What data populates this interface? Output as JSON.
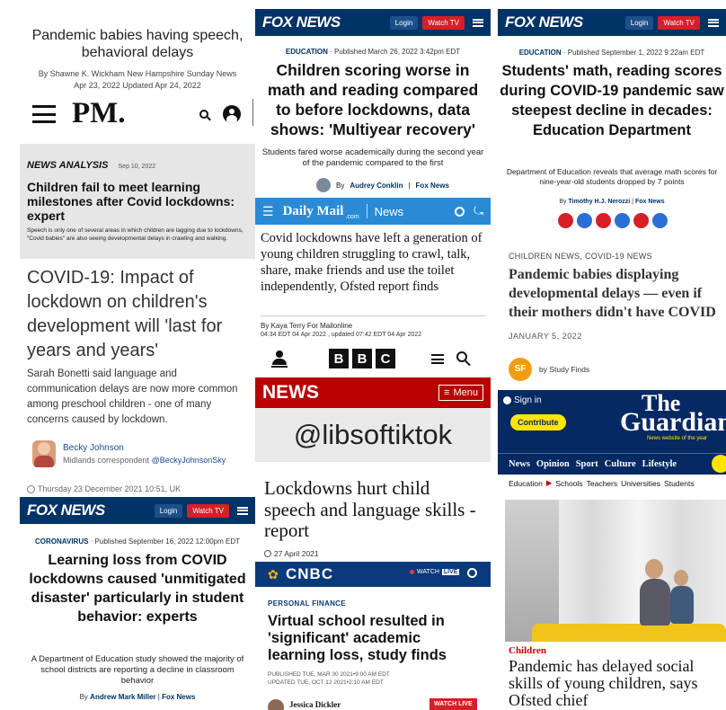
{
  "p1": {
    "title": "Pandemic babies having speech, behavioral delays",
    "byline": "By Shawne K. Wickham New Hampshire Sunday News",
    "dateline": "Apr 23, 2022 Updated Apr 24, 2022",
    "logo": "PM."
  },
  "p2": {
    "label": "NEWS ANALYSIS",
    "date": "Sep 10, 2022",
    "headline": "Children fail to meet learning milestones after Covid lockdowns: expert",
    "summary": "Speech is only one of several areas in which children are lagging due to lockdowns, \"Covid babies\" are also seeing developmental delays in crawling and walking."
  },
  "p3": {
    "headline": "COVID-19: Impact of lockdown on children's development will 'last for years and years'",
    "summary": "Sarah Bonetti said language and communication delays are now more common among preschool children - one of many concerns caused by lockdown.",
    "author": "Becky Johnson",
    "role": "Midlands correspondent",
    "handle": "@BeckyJohnsonSky",
    "timestamp": "Thursday 23 December 2021 10:51, UK"
  },
  "fox": {
    "logo": "FOX NEWS",
    "login": "Login",
    "watch": "Watch TV"
  },
  "p4": {
    "section": "CORONAVIRUS",
    "published": "Published September 16, 2022 12:00pm EDT",
    "headline": "Learning loss from COVID lockdowns caused 'unmitigated disaster' particularly in student behavior: experts",
    "summary": "A Department of Education study showed the majority of school districts are reporting a decline in classroom behavior",
    "byline_prefix": "By",
    "author": "Andrew Mark Miller",
    "outlet": "Fox News"
  },
  "p5": {
    "section": "EDUCATION",
    "published": "Published March 26, 2022 3:42pm EDT",
    "headline": "Children scoring worse in math and reading compared to before lockdowns, data shows: 'Multiyear recovery'",
    "summary": "Students fared worse academically during the second year of the pandemic compared to the first",
    "byline_prefix": "By",
    "author": "Audrey Conklin",
    "outlet": "Fox News"
  },
  "p6": {
    "brand": "Daily Mail",
    "brand_sub": ".com",
    "section": "News",
    "headline": "Covid lockdowns have left a generation of young children struggling to crawl, talk, share, make friends and use the toilet independently, Ofsted report finds",
    "byline": "By Kaya Terry For Mailonline",
    "timestamp": "04:34 EDT 04 Apr 2022 , updated 07:42 EDT 04 Apr 2022"
  },
  "p7": {
    "letters": [
      "B",
      "B",
      "C"
    ],
    "news": "NEWS",
    "menu": "Menu",
    "watermark": "@libsoftiktok",
    "headline": "Lockdowns hurt child speech and language skills - report",
    "date": "27 April 2021"
  },
  "p8": {
    "logo": "CNBC",
    "watch": "WATCH",
    "live": "LIVE",
    "section": "PERSONAL FINANCE",
    "headline": "Virtual school resulted in 'significant' academic learning loss, study finds",
    "published": "PUBLISHED TUE, MAR 30 2021•9:00 AM EDT",
    "updated": "UPDATED TUE, OCT 12 2021•2:10 AM EDT",
    "author": "Jessica Dickler",
    "watch_live": "WATCH LIVE"
  },
  "p9": {
    "section": "EDUCATION",
    "published": "Published September 1, 2022 9:22am EDT",
    "headline": "Students' math, reading scores during COVID-19 pandemic saw steepest decline in decades: Education Department",
    "summary": "Department of Education reveals that average math scores for nine-year-old students dropped by 7 points",
    "byline_prefix": "By",
    "author": "Timothy H.J. Nerozzi",
    "outlet": "Fox News"
  },
  "p10": {
    "category": "CHILDREN NEWS, COVID-19 NEWS",
    "headline": "Pandemic babies displaying developmental delays — even if their mothers didn't have COVID",
    "date": "JANUARY 5, 2022",
    "logo": "SF",
    "byline": "by Study Finds"
  },
  "p11": {
    "signin": "Sign in",
    "contribute": "Contribute",
    "logo_line1": "The",
    "logo_line2": "Guardian",
    "tagline": "News website of the year",
    "nav": [
      "News",
      "Opinion",
      "Sport",
      "Culture",
      "Lifestyle"
    ],
    "crumb_root": "Education",
    "crumbs": [
      "Schools",
      "Teachers",
      "Universities",
      "Students"
    ],
    "tag": "Children",
    "headline": "Pandemic has delayed social skills of young children, says Ofsted chief"
  },
  "colors": {
    "fox_blue": "#003366",
    "watch_red": "#d61f26",
    "mail_blue": "#2a8ad5",
    "bbc_red": "#b80000",
    "cnbc_blue": "#0a3a7c",
    "guardian_blue": "#052962",
    "guardian_yellow": "#ffe500",
    "guardian_red": "#c70000"
  }
}
